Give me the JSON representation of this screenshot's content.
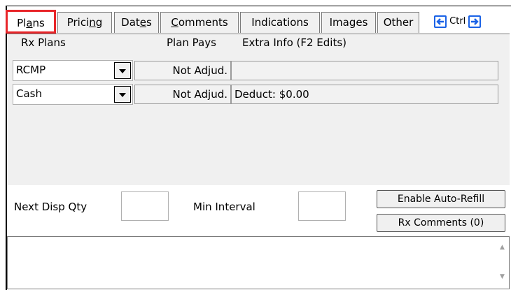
{
  "tabs": [
    {
      "label_pre": "Pl",
      "label_u": "a",
      "label_post": "ns",
      "active": true
    },
    {
      "label_pre": "Prici",
      "label_u": "n",
      "label_post": "g",
      "active": false
    },
    {
      "label_pre": "Dat",
      "label_u": "e",
      "label_post": "s",
      "active": false
    },
    {
      "label_pre": "",
      "label_u": "C",
      "label_post": "omments",
      "active": false
    },
    {
      "label_pre": "Indications",
      "label_u": "",
      "label_post": "",
      "active": false
    },
    {
      "label_pre": "Images",
      "label_u": "",
      "label_post": "",
      "active": false
    },
    {
      "label_pre": "Other",
      "label_u": "",
      "label_post": "",
      "active": false
    }
  ],
  "nav": {
    "ctrl_label": "Ctrl"
  },
  "headers": {
    "rx_plans": "Rx Plans",
    "plan_pays": "Plan Pays",
    "extra_info": "Extra Info (F2 Edits)"
  },
  "plans": [
    {
      "name": "RCMP",
      "pays": "Not Adjud.",
      "extra": ""
    },
    {
      "name": "Cash",
      "pays": "Not Adjud.",
      "extra": "Deduct: $0.00"
    }
  ],
  "fields": {
    "next_disp_qty_label": "Next Disp Qty",
    "next_disp_qty_value": "",
    "min_interval_label": "Min Interval",
    "min_interval_value": ""
  },
  "buttons": {
    "enable_auto_refill": "Enable Auto-Refill",
    "rx_comments": "Rx Comments (0)"
  },
  "memo": {
    "text": ""
  },
  "colors": {
    "active_tab_border": "#e8262a",
    "nav_arrow": "#1a62e6",
    "panel_bg": "#f0f0f0"
  }
}
